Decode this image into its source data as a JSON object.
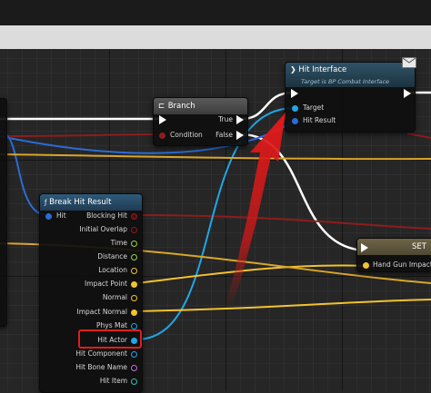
{
  "nodes": {
    "branch": {
      "title": "Branch",
      "pins": {
        "true_label": "True",
        "condition_label": "Condition",
        "false_label": "False"
      }
    },
    "hit_interface": {
      "title": "Hit Interface",
      "subtitle": "Target is BP Combat Interface",
      "pins": {
        "target_label": "Target",
        "hit_result_label": "Hit Result"
      }
    },
    "break_hit_result": {
      "title": "Break Hit Result",
      "input_label": "Hit",
      "outputs": [
        "Blocking Hit",
        "Initial Overlap",
        "Time",
        "Distance",
        "Location",
        "Impact Point",
        "Normal",
        "Impact Normal",
        "Phys Mat",
        "Hit Actor",
        "Hit Component",
        "Hit Bone Name",
        "Hit Item"
      ]
    },
    "set": {
      "title": "SET",
      "pin_label": "Hand Gun Impact P"
    }
  },
  "colors": {
    "exec": "#ffffff",
    "bool": "#8c1d1d",
    "struct": "#2b6cd6",
    "object": "#1fa7e6",
    "float": "#9bd24a",
    "vector": "#f2c230",
    "highlight": "#e11d1d"
  },
  "icons": {
    "message": "envelope-icon",
    "branch": "branch-icon",
    "function": "function-icon"
  }
}
